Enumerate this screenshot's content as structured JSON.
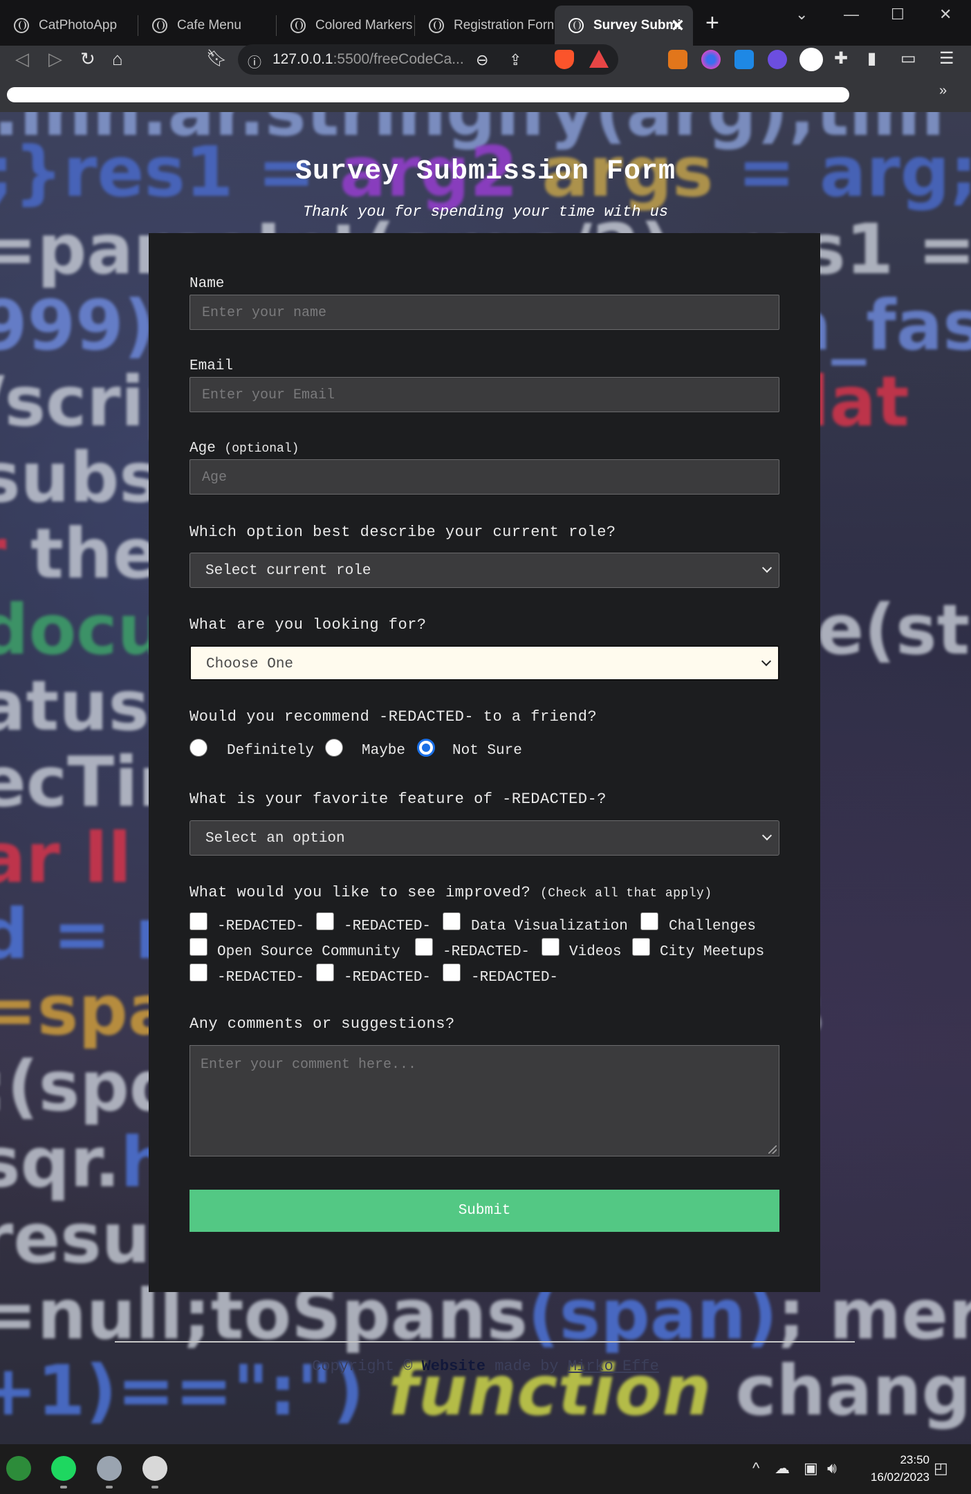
{
  "browser": {
    "tabs": [
      {
        "label": "CatPhotoApp",
        "active": false
      },
      {
        "label": "Cafe Menu",
        "active": false
      },
      {
        "label": "Colored Markers",
        "active": false
      },
      {
        "label": "Registration Form",
        "active": false
      },
      {
        "label": "Survey Submi",
        "active": true
      }
    ],
    "url_host": "127.0.0.1",
    "url_path": ":5500/freeCodeCa..."
  },
  "page": {
    "title": "Survey Submission Form",
    "description": "Thank you for spending your time with us"
  },
  "form": {
    "name": {
      "label": "Name",
      "placeholder": "Enter your name"
    },
    "email": {
      "label": "Email",
      "placeholder": "Enter your Email"
    },
    "age": {
      "label": "Age",
      "hint": "(optional)",
      "placeholder": "Age"
    },
    "role": {
      "question": "Which option best describe your current role?",
      "selected": "Select current role"
    },
    "looking_for": {
      "question": "What are you looking for?",
      "selected": "Choose One"
    },
    "recommend": {
      "question": "Would you recommend -REDACTED- to a friend?",
      "options": [
        "Definitely",
        "Maybe",
        "Not Sure"
      ],
      "selected": "Not Sure"
    },
    "favorite": {
      "question": "What is your favorite feature of -REDACTED-?",
      "selected": "Select an option"
    },
    "improve": {
      "question": "What would you like to see improved?",
      "hint": "(Check all that apply)",
      "options": [
        "-REDACTED-",
        "-REDACTED-",
        "Data Visualization",
        "Challenges",
        "Open Source Community",
        "-REDACTED-",
        "Videos",
        "City Meetups",
        "-REDACTED-",
        "-REDACTED-",
        "-REDACTED-"
      ]
    },
    "comments": {
      "question": "Any comments or suggestions?",
      "placeholder": "Enter your comment here..."
    },
    "submit_label": "Submit"
  },
  "footer": {
    "prefix": "Copyright © ",
    "site": "Website",
    "made_by": " made by ",
    "author": "Mirko Effe"
  },
  "taskbar": {
    "time": "23:50",
    "date": "16/02/2023"
  },
  "colors": {
    "submit": "#53c884",
    "card": "#1c1d1f",
    "radio_selected": "#1a6fe6"
  }
}
